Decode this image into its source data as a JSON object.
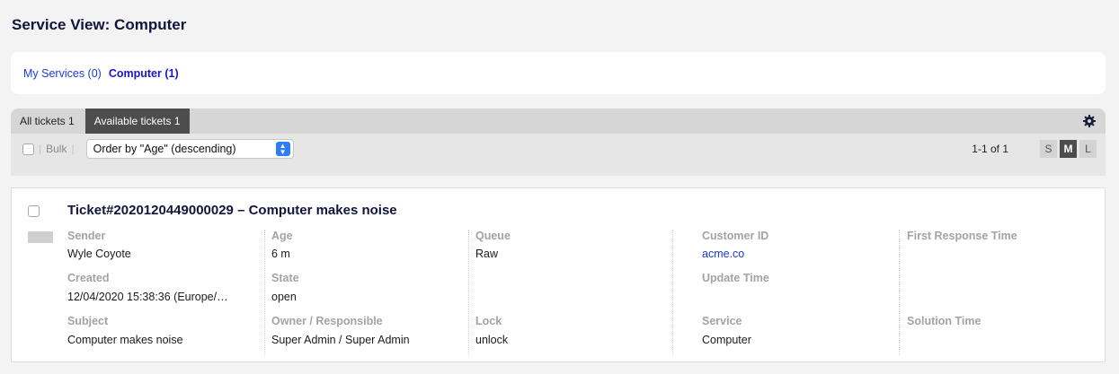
{
  "page": {
    "title": "Service View: Computer"
  },
  "services": [
    {
      "label": "My Services (0)",
      "active": false
    },
    {
      "label": "Computer (1)",
      "active": true
    }
  ],
  "tabs": [
    {
      "label": "All tickets 1",
      "active": false
    },
    {
      "label": "Available tickets 1",
      "active": true
    }
  ],
  "toolbar": {
    "bulk_label": "Bulk",
    "order_value": "Order by \"Age\" (descending)",
    "paging": "1-1 of 1",
    "sizes": [
      "S",
      "M",
      "L"
    ],
    "active_size": "M",
    "settings_icon": "gear-icon"
  },
  "ticket": {
    "title": "Ticket#2020120449000029 – Computer makes noise",
    "columns": [
      {
        "fields": [
          {
            "label": "Sender",
            "value": "Wyle Coyote"
          },
          {
            "label": "Created",
            "value": "12/04/2020 15:38:36 (Europe/…"
          },
          {
            "label": "Subject",
            "value": "Computer makes noise"
          }
        ]
      },
      {
        "fields": [
          {
            "label": "Age",
            "value": "6 m"
          },
          {
            "label": "State",
            "value": "open"
          },
          {
            "label": "Owner / Responsible",
            "value": "Super Admin / Super Admin"
          }
        ]
      },
      {
        "fields": [
          {
            "label": "Queue",
            "value": "Raw"
          },
          {
            "label": "Lock",
            "value": "unlock"
          }
        ]
      },
      {
        "fields": [
          {
            "label": "Customer ID",
            "value": "acme.co"
          },
          {
            "label": "Update Time",
            "value": ""
          },
          {
            "label": "Service",
            "value": "Computer"
          }
        ]
      },
      {
        "fields": [
          {
            "label": "First Response Time",
            "value": ""
          },
          {
            "label": "Solution Time",
            "value": ""
          }
        ]
      }
    ]
  }
}
